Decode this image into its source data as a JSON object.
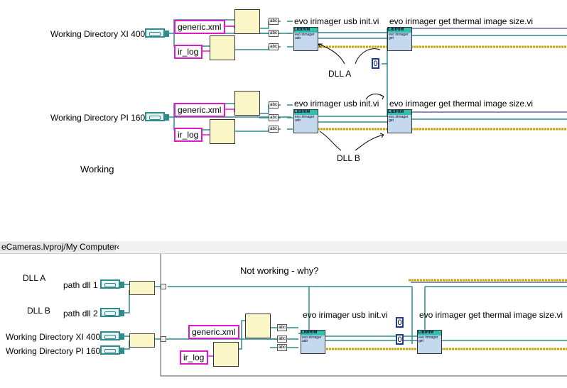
{
  "top": {
    "inputs": [
      "Working Directory XI 400",
      "Working Directory PI 160"
    ],
    "strings": [
      "generic.xml",
      "ir_log"
    ],
    "vi_init": "evo irimager usb init.vi",
    "vi_size": "evo irimager get thermal image size.vi",
    "dll_a": "DLL A",
    "dll_b": "DLL B",
    "status": "Working",
    "zero": "0",
    "vi_header": "LIBIRIM",
    "vi_body": "evo irimager usb",
    "vi_body2": "evo irimager get"
  },
  "bottom": {
    "tab_path": "eCameras.lvproj/My Computer",
    "caption": "Not working - why?",
    "dll_a": "DLL A",
    "dll_b": "DLL B",
    "path_dll_1": "path dll 1",
    "path_dll_2": "path dll 2",
    "inputs": [
      "Working Directory XI 400",
      "Working Directory PI 160"
    ],
    "strings": [
      "generic.xml",
      "ir_log"
    ],
    "vi_init": "evo irimager usb init.vi",
    "vi_size": "evo irimager get thermal image size.vi",
    "zero": "0"
  }
}
